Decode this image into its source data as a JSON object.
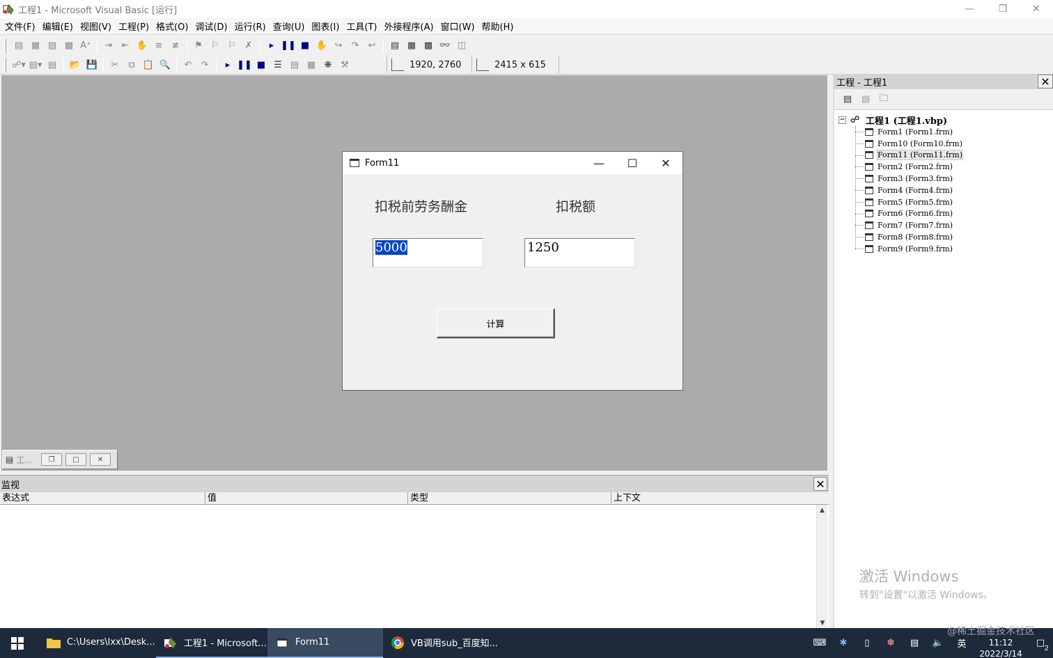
{
  "window": {
    "title": "工程1 - Microsoft Visual Basic [运行]"
  },
  "menu": [
    "文件(F)",
    "编辑(E)",
    "视图(V)",
    "工程(P)",
    "格式(O)",
    "调试(D)",
    "运行(R)",
    "查询(U)",
    "图表(I)",
    "工具(T)",
    "外接程序(A)",
    "窗口(W)",
    "帮助(H)"
  ],
  "toolbar": {
    "position": "1920, 2760",
    "size": "2415 x 615"
  },
  "mdi_minimized": {
    "title": "工..."
  },
  "form": {
    "title": "Form11",
    "label_pre_tax": "扣税前劳务酬金",
    "label_tax": "扣税额",
    "input_pre_tax": "5000",
    "input_tax": "1250",
    "button_calc": "计算"
  },
  "project": {
    "header": "工程 - 工程1",
    "root": "工程1 (工程1.vbp)",
    "items": [
      "Form1 (Form1.frm)",
      "Form10 (Form10.frm)",
      "Form11 (Form11.frm)",
      "Form2 (Form2.frm)",
      "Form3 (Form3.frm)",
      "Form4 (Form4.frm)",
      "Form5 (Form5.frm)",
      "Form6 (Form6.frm)",
      "Form7 (Form7.frm)",
      "Form8 (Form8.frm)",
      "Form9 (Form9.frm)"
    ],
    "selected_index": 2
  },
  "activation": {
    "line1": "激活 Windows",
    "line2": "转到\"设置\"以激活 Windows。"
  },
  "watch": {
    "header": "监视",
    "columns": [
      "表达式",
      "值",
      "类型",
      "上下文"
    ]
  },
  "taskbar": {
    "buttons": [
      {
        "label": "C:\\Users\\lxx\\Desk...",
        "icon": "folder-icon"
      },
      {
        "label": "工程1 - Microsoft...",
        "icon": "vb-icon"
      },
      {
        "label": "Form11",
        "icon": "form-icon"
      },
      {
        "label": "VB调用sub_百度知...",
        "icon": "chrome-icon"
      }
    ],
    "ime": "英",
    "time": "11:12",
    "date": "2022/3/14",
    "notification_count": "2"
  },
  "site_watermark": "@稀土掘金技术社区"
}
